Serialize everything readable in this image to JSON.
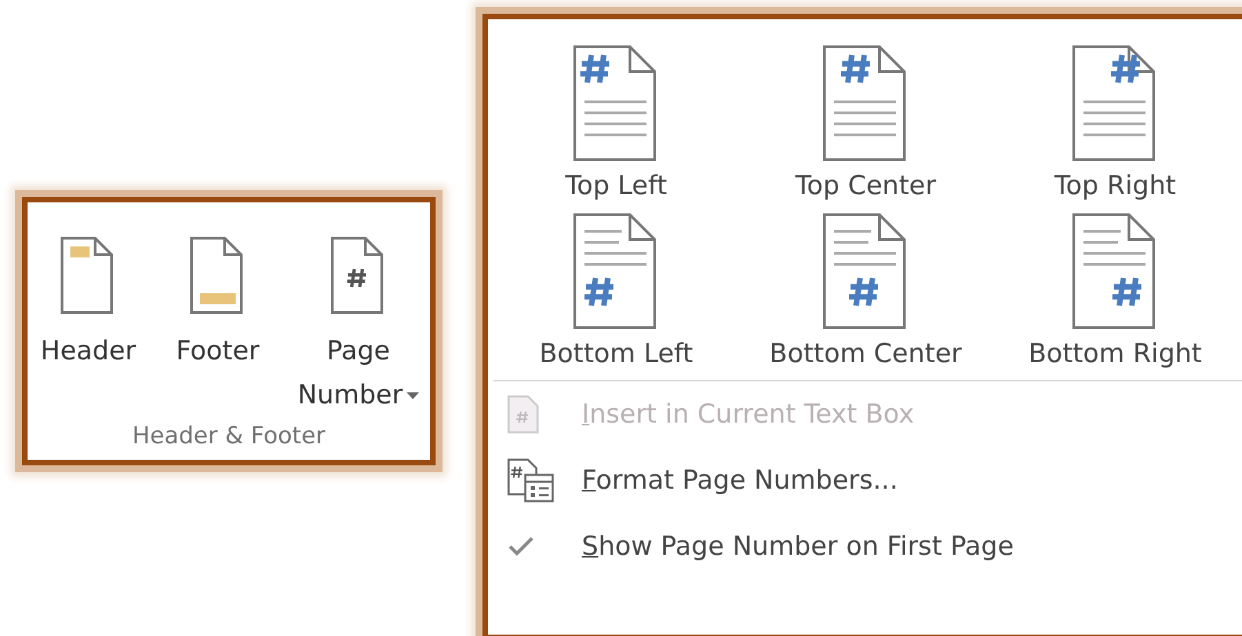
{
  "ribbon_group": {
    "label": "Header & Footer",
    "buttons": [
      {
        "kind": "header",
        "label": "Header",
        "dropdown": false
      },
      {
        "kind": "footer",
        "label": "Footer",
        "dropdown": false
      },
      {
        "kind": "page-number",
        "label": "Page Number",
        "dropdown": true
      }
    ]
  },
  "menu": {
    "gallery": [
      {
        "kind": "topleft",
        "label": "Top Left"
      },
      {
        "kind": "topcenter",
        "label": "Top Center"
      },
      {
        "kind": "topright",
        "label": "Top Right"
      },
      {
        "kind": "bottomleft",
        "label": "Bottom Left"
      },
      {
        "kind": "bottomcenter",
        "label": "Bottom Center"
      },
      {
        "kind": "bottomright",
        "label": "Bottom Right"
      }
    ],
    "items": [
      {
        "kind": "textbox",
        "label": "Insert in Current Text Box",
        "access_key_underlined": true,
        "disabled": true
      },
      {
        "kind": "format",
        "label": "Format Page Numbers...",
        "access_key_underlined": true,
        "disabled": false
      },
      {
        "kind": "toggle",
        "label": "Show Page Number on First Page",
        "access_key_underlined": true,
        "disabled": false,
        "checked": true
      }
    ]
  }
}
